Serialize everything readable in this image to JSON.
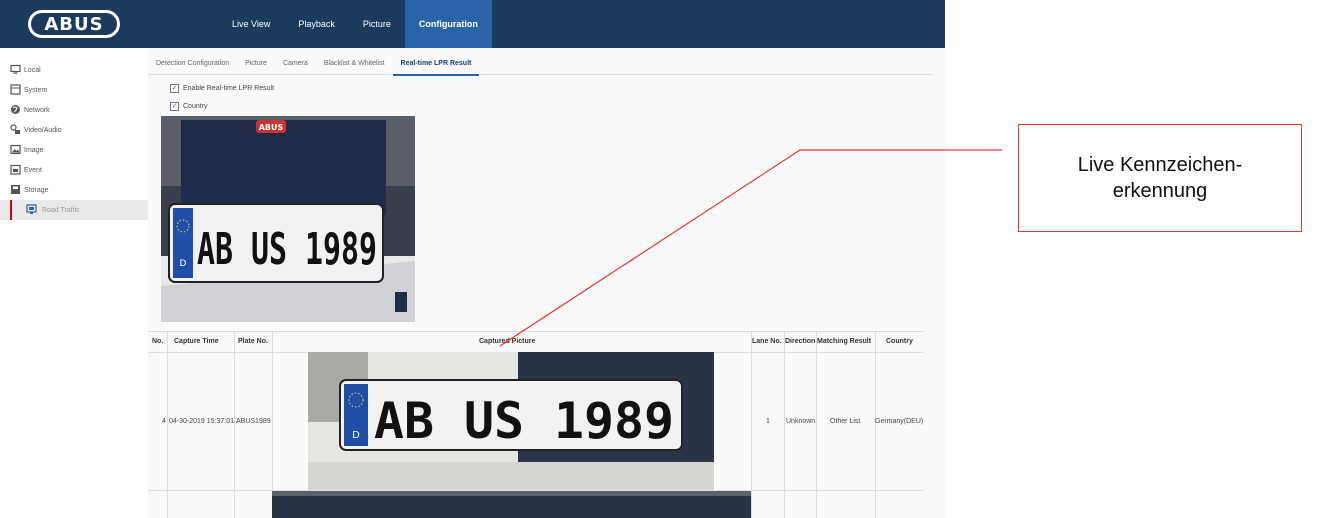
{
  "brand": "ABUS",
  "nav": [
    "Live View",
    "Playback",
    "Picture",
    "Configuration"
  ],
  "sidebar": [
    {
      "label": "Local",
      "icon": "monitor-icon"
    },
    {
      "label": "System",
      "icon": "system-icon"
    },
    {
      "label": "Network",
      "icon": "globe-icon"
    },
    {
      "label": "Video/Audio",
      "icon": "video-audio-icon"
    },
    {
      "label": "Image",
      "icon": "image-icon"
    },
    {
      "label": "Event",
      "icon": "calendar-icon"
    },
    {
      "label": "Storage",
      "icon": "storage-icon"
    },
    {
      "label": "Road Traffic",
      "icon": "road-traffic-icon"
    }
  ],
  "tabs": [
    "Detection Configuration",
    "Picture",
    "Camera",
    "Blacklist & Whitelist",
    "Real-time LPR Result"
  ],
  "options": {
    "enable_lpr": "Enable Real-time LPR Result",
    "country": "Country"
  },
  "live_plate": {
    "country_code": "D",
    "text": "AB  US 1989",
    "sticker": "ABUS"
  },
  "table": {
    "headers": {
      "no": "No.",
      "capture_time": "Capture Time",
      "plate_no": "Plate No.",
      "captured_picture": "Captured Picture",
      "lane_no": "Lane No.",
      "direction": "Direction",
      "matching_result": "Matching Result",
      "country": "Country"
    },
    "rows": [
      {
        "no": "4",
        "capture_time": "04-30-2019 15:37:01",
        "plate_no": "ABUS1989",
        "plate_text": "AB  US 1989",
        "plate_cc": "D",
        "lane_no": "1",
        "direction": "Unknown",
        "matching_result": "Other List",
        "country": "Germany(DEU)"
      }
    ]
  },
  "annotation": {
    "line1": "Live Kennzeichen-",
    "line2": "erkennung",
    "color": "#e53935"
  },
  "colors": {
    "header_bg": "#1b3a5e",
    "active_tab": "#2a64a8",
    "plate_blue": "#1f4fa8"
  }
}
